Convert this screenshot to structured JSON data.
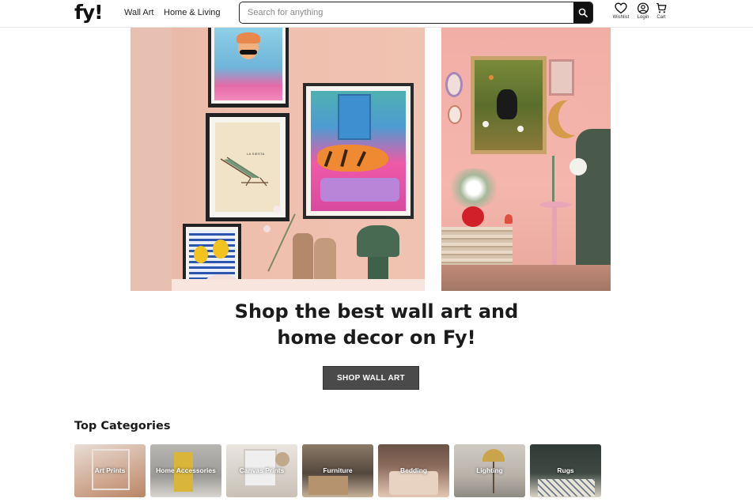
{
  "header": {
    "logo": "fy!",
    "nav": [
      "Wall Art",
      "Home & Living"
    ],
    "search_placeholder": "Search for anything",
    "icons": [
      {
        "label": "Wishlist",
        "icon": "heart-icon"
      },
      {
        "label": "Login",
        "icon": "user-icon"
      },
      {
        "label": "Cart",
        "icon": "cart-icon"
      }
    ]
  },
  "hero": {
    "poster_text": "LA SIESTA",
    "headline_line1": "Shop the best wall art and",
    "headline_line2": "home decor on Fy!",
    "cta_label": "SHOP WALL ART"
  },
  "categories_title": "Top Categories",
  "categories": [
    {
      "label": "Art Prints",
      "color": "#c9a490"
    },
    {
      "label": "Home Accessories",
      "color": "#a9a7a3"
    },
    {
      "label": "Canvas Prints",
      "color": "#d3ccc4"
    },
    {
      "label": "Furniture",
      "color": "#5d5146"
    },
    {
      "label": "Bedding",
      "color": "#8a6a5a"
    },
    {
      "label": "Lighting",
      "color": "#bfbab2"
    },
    {
      "label": "Rugs",
      "color": "#3f4a44"
    }
  ]
}
